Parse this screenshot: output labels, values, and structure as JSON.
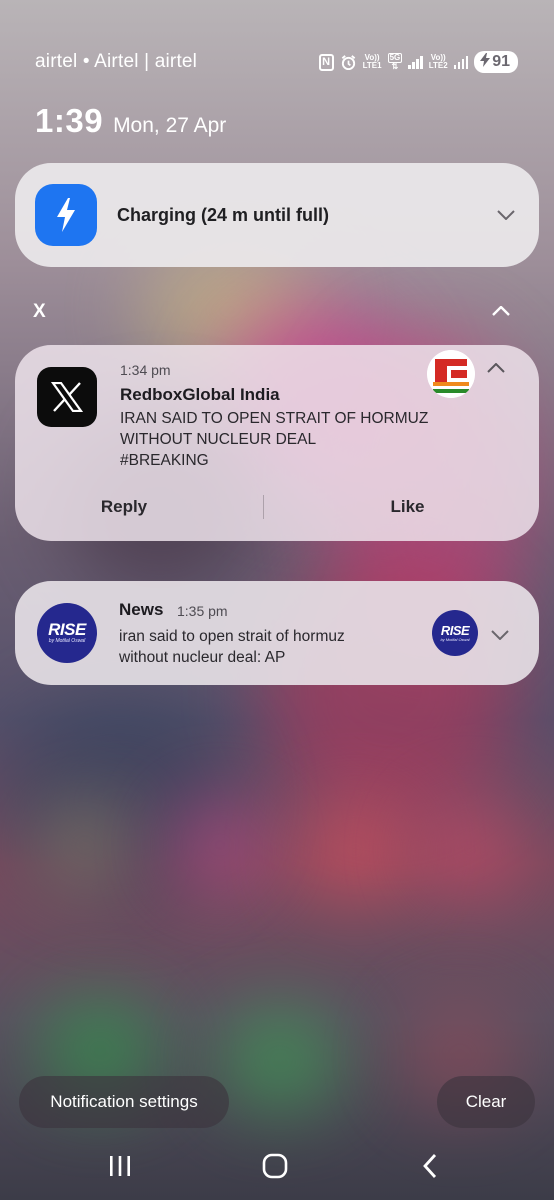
{
  "status_bar": {
    "carrier": "airtel • Airtel | airtel",
    "sim1_tag": "Vo))",
    "sim1_net": "LTE1",
    "sim2_tag": "Vo))",
    "sim2_net": "LTE2",
    "data_type": "5G",
    "battery": "91",
    "icons": [
      "nfc-icon",
      "alarm-icon",
      "signal-icon",
      "charging-bolt-icon"
    ]
  },
  "header": {
    "time": "1:39",
    "date": "Mon, 27 Apr"
  },
  "charging": {
    "text": "Charging (24 m until full)",
    "icon": "lightning-bolt-icon",
    "accent": "#1e75f1"
  },
  "group": {
    "app": "X"
  },
  "x_notification": {
    "time": "1:34 pm",
    "title": "RedboxGlobal India",
    "body_lines": [
      "IRAN SAID TO OPEN STRAIT OF HORMUZ",
      "WITHOUT NUCLEUR DEAL",
      "#BREAKING"
    ],
    "actions": [
      "Reply",
      "Like"
    ]
  },
  "news_notification": {
    "app": "News",
    "time": "1:35 pm",
    "body_lines": [
      "iran said to open strait of hormuz",
      "without nucleur deal: AP"
    ],
    "logo_word": "RISE",
    "logo_sub": "by Motilal Oswal",
    "accent": "#25288e"
  },
  "footer": {
    "settings": "Notification settings",
    "clear": "Clear"
  },
  "navbar": {
    "icons": [
      "recent-apps-icon",
      "home-icon",
      "back-icon"
    ]
  }
}
